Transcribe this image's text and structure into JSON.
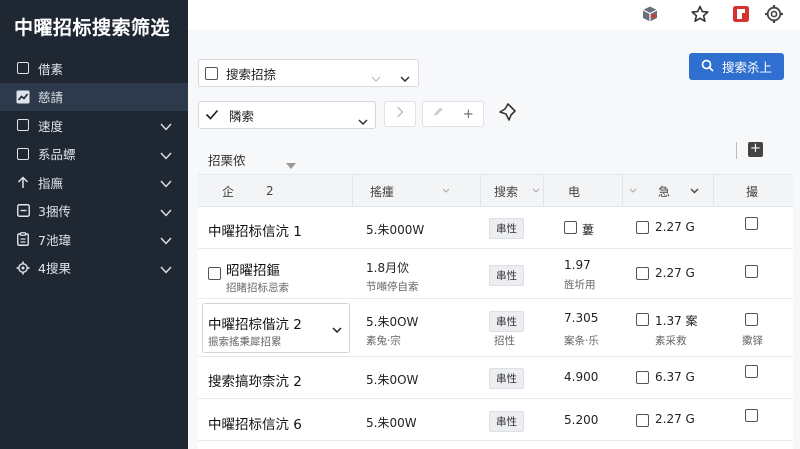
{
  "app": {
    "title": "中曜招标搜索筛选"
  },
  "sidebar": {
    "items": [
      {
        "label": "借素",
        "icon": "checkbox-icon",
        "active": false,
        "expandable": false
      },
      {
        "label": "慈請",
        "icon": "trend-chart-icon",
        "active": true,
        "expandable": false
      },
      {
        "label": "速度",
        "icon": "checkbox-icon",
        "active": false,
        "expandable": true
      },
      {
        "label": "系品螵",
        "icon": "checkbox-icon",
        "active": false,
        "expandable": true
      },
      {
        "label": "指廡",
        "icon": "arrow-up-icon",
        "active": false,
        "expandable": true
      },
      {
        "label": "3捆传",
        "icon": "minus-box-icon",
        "active": false,
        "expandable": true
      },
      {
        "label": "7池瑋",
        "icon": "clipboard-icon",
        "active": false,
        "expandable": true
      },
      {
        "label": "4搜果",
        "icon": "gear-icon",
        "active": false,
        "expandable": true
      }
    ]
  },
  "topbar": {
    "icons": [
      "cube-icon",
      "star-icon",
      "red-app-icon",
      "settings-icon"
    ]
  },
  "filters": {
    "search_select_label": "搜索招捺",
    "sort_select_label": "隣索",
    "search_button_label": "搜索杀上",
    "plus_label": "+"
  },
  "group": {
    "label": "招栗侬"
  },
  "table": {
    "headers": {
      "col1_a": "企",
      "col1_b": "2",
      "col2": "搖瘇",
      "col3": "搜索",
      "col4": "电",
      "col5": "急",
      "col6": "撮"
    },
    "rows": [
      {
        "name": "中曜招标信沆 1",
        "sub": "",
        "amount": "5.朱000W",
        "amount_sub": "",
        "tag": "串性",
        "c4": "",
        "c4_check_label": "蔞",
        "c4_sub": "",
        "c5": "2.27 G",
        "c5_sub": "",
        "c6_sub": ""
      },
      {
        "name": "昭曜招鏂",
        "sub": "招睹招标忌索",
        "amount": "1.8月佽",
        "amount_sub": "节噸停自索",
        "tag": "串性",
        "c4": "1.97",
        "c4_check_label": "",
        "c4_sub": "旌圻用",
        "c5": "2.27 G",
        "c5_sub": "",
        "c6_sub": ""
      },
      {
        "name": "中曜招棕偕沆 2",
        "sub": "振索搖秉犀招累",
        "amount": "5.朱0OW",
        "amount_sub": "素兔·宗",
        "tag": "串性",
        "c4": "7.305",
        "c4_check_label": "",
        "c4_sub": "案条·乐",
        "c5": "1.37 案",
        "c5_sub": "素采救",
        "c6_sub": "擹铎"
      },
      {
        "name": "搜索搞珎柰沆 2",
        "sub": "",
        "amount": "5.朱0OW",
        "amount_sub": "",
        "tag": "串性",
        "c4": "4.900",
        "c4_check_label": "",
        "c4_sub": "",
        "c5": "6.37 G",
        "c5_sub": "",
        "c6_sub": ""
      },
      {
        "name": "中曜招标信沆 6",
        "sub": "",
        "amount": "5.朱00W",
        "amount_sub": "",
        "tag": "串性",
        "c4": "5.200",
        "c4_check_label": "",
        "c4_sub": "",
        "c5": "2.27 G",
        "c5_sub": "",
        "c6_sub": ""
      }
    ]
  }
}
